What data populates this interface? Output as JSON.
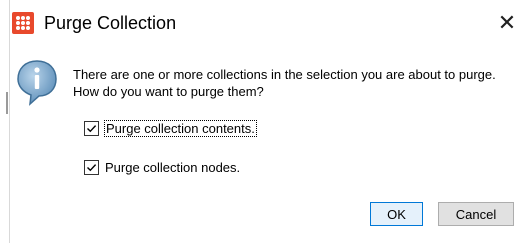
{
  "dialog": {
    "title": "Purge Collection",
    "close_label": "✕",
    "message": "There are one or more collections in the selection you are about to purge. How do you want to purge them?",
    "options": [
      {
        "label": "Purge collection contents.",
        "checked": true
      },
      {
        "label": "Purge collection nodes.",
        "checked": true
      }
    ],
    "buttons": {
      "ok": "OK",
      "cancel": "Cancel"
    }
  },
  "colors": {
    "app_icon": "#e8492c",
    "info_icon_fill": "#6f9fc6",
    "default_button_border": "#0078d7"
  },
  "icons": [
    "app-icon",
    "close-icon",
    "info-icon",
    "check-icon"
  ]
}
